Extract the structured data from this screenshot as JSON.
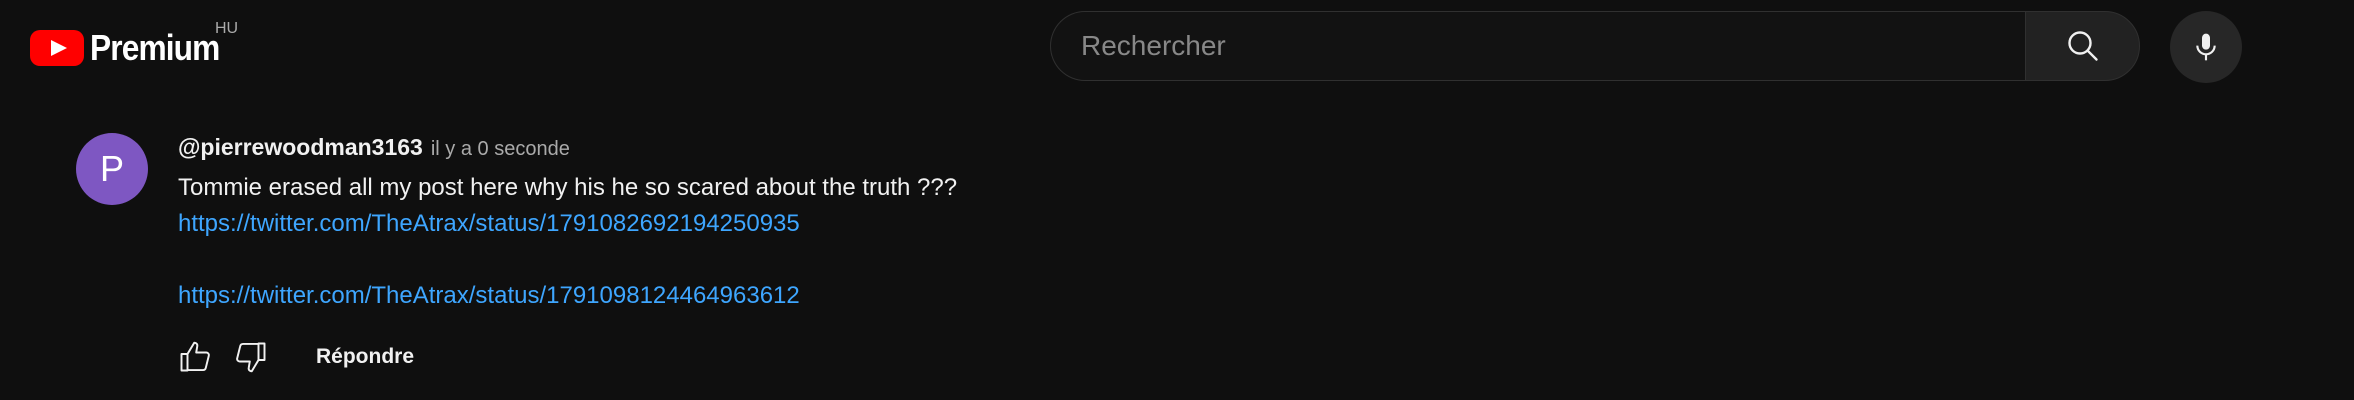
{
  "header": {
    "logo_text": "Premium",
    "country_code": "HU",
    "search_placeholder": "Rechercher",
    "search_value": ""
  },
  "comment": {
    "avatar_letter": "P",
    "avatar_color": "#7e57c2",
    "author": "@pierrewoodman3163",
    "time": "il y a 0 seconde",
    "text": "Tommie erased all my post here why his he so scared about the truth ???",
    "links": [
      "https://twitter.com/TheAtrax/status/1791082692194250935",
      "https://twitter.com/TheAtrax/status/1791098124464963612"
    ]
  },
  "actions": {
    "like_icon": "thumb-up-icon",
    "dislike_icon": "thumb-down-icon",
    "reply_label": "Répondre"
  },
  "colors": {
    "background": "#0f0f0f",
    "link": "#3ea6ff",
    "brand_red": "#ff0000"
  }
}
